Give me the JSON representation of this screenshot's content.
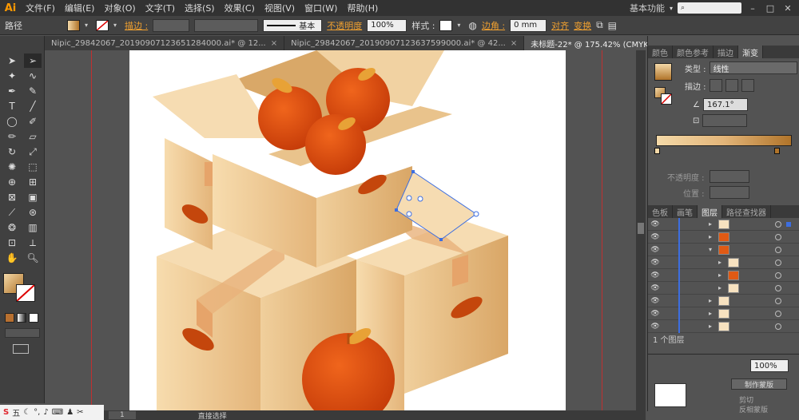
{
  "app": {
    "logo": "Ai"
  },
  "menu": [
    "文件(F)",
    "编辑(E)",
    "对象(O)",
    "文字(T)",
    "选择(S)",
    "效果(C)",
    "视图(V)",
    "窗口(W)",
    "帮助(H)"
  ],
  "menu_right": {
    "workspace": "基本功能",
    "search_placeholder": ""
  },
  "control": {
    "path_label": "路径",
    "stroke_label": "描边 :",
    "stroke_style": "基本",
    "opacity_label": "不透明度",
    "opacity_value": "100%",
    "style_label": "样式 :",
    "corner_label": "边角 :",
    "corner_value": "0 mm",
    "align_label": "对齐",
    "transform_label": "变换"
  },
  "tabs": [
    {
      "label": "Nipic_29842067_20190907123651284000.ai* @ 12...",
      "active": false
    },
    {
      "label": "Nipic_29842067_20190907123637599000.ai* @ 42...",
      "active": false
    },
    {
      "label": "未标题-22* @ 175.42% (CMYK/预览)",
      "active": true
    }
  ],
  "panel_tabs_top": [
    {
      "label": "颜色",
      "active": false
    },
    {
      "label": "颜色参考",
      "active": false
    },
    {
      "label": "描边",
      "active": false
    },
    {
      "label": "渐变",
      "active": true
    }
  ],
  "gradient": {
    "type_label": "类型 :",
    "type_value": "线性",
    "stroke_label": "描边 :",
    "angle_value": "167.1°",
    "opacity_label": "不透明度 :",
    "position_label": "位置 :"
  },
  "panel_tabs_layers": [
    {
      "label": "色板",
      "active": false
    },
    {
      "label": "画笔",
      "active": false
    },
    {
      "label": "图层",
      "active": true
    },
    {
      "label": "路径查找器",
      "active": false
    }
  ],
  "layers": {
    "count_label": "1 个图层",
    "rows": [
      {
        "indent": 0,
        "thumb": "light"
      },
      {
        "indent": 0,
        "thumb": "orange"
      },
      {
        "indent": 0,
        "thumb": "orange"
      },
      {
        "indent": 1,
        "thumb": "light"
      },
      {
        "indent": 1,
        "thumb": "orange"
      },
      {
        "indent": 1,
        "thumb": "light"
      },
      {
        "indent": 0,
        "thumb": "light"
      },
      {
        "indent": 0,
        "thumb": "light"
      },
      {
        "indent": 0,
        "thumb": "light"
      }
    ]
  },
  "bottom_panel": {
    "opacity_value": "100%",
    "make_mask": "制作蒙版",
    "clip": "剪切",
    "invert_mask": "反相蒙版"
  },
  "status": {
    "zoom": "175.42%",
    "page": "1",
    "tool": "直接选择"
  },
  "taskbar": {
    "ime": "五"
  },
  "colors": {
    "accent": "#f0a030",
    "selection": "#3d6ee0",
    "guide": "#c03030"
  }
}
